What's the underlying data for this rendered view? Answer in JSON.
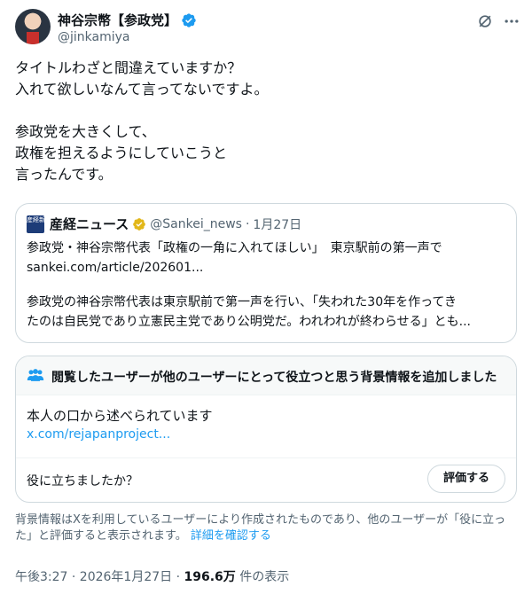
{
  "author": {
    "name": "神谷宗幣【参政党】",
    "handle": "@jinkamiya"
  },
  "tweet": {
    "text": "タイトルわざと間違えていますか？\n入れて欲しいなんて言ってないですよ。\n\n参政党を大きくして、\n政権を担えるようにしていこうと\n言ったんです。"
  },
  "quote": {
    "logo_text": "産経新聞",
    "name": "産経ニュース",
    "handle": "@Sankei_news",
    "separator": "·",
    "date": "1月27日",
    "title": "参政党・神谷宗幣代表「政権の一角に入れてほしい」　東京駅前の第一声で",
    "url": "sankei.com/article/202601...",
    "body_line1": "参政党の神谷宗幣代表は東京駅前で第一声を行い、「失われた30年を作ってき",
    "body_line2": "たのは自民党であり立憲民主党であり公明党だ。われわれが終わらせる」とも..."
  },
  "community_note": {
    "title": "閲覧したユーザーが他のユーザーにとって役立つと思う背景情報を追加しました",
    "text": "本人の口から述べられています",
    "link": "x.com/rejapanproject...",
    "question": "役に立ちましたか？",
    "rate_label": "評価する"
  },
  "disclaimer": {
    "text": "背景情報はXを利用しているユーザーにより作成されたものであり、他のユーザーが「役に立った」と評価すると表示されます。 ",
    "link": "詳細を確認する"
  },
  "footer": {
    "time": "午後3:27 · 2026年1月27日 · ",
    "views": "196.6万",
    "views_label": " 件の表示"
  },
  "colors": {
    "text": "#0f1419",
    "secondary": "#536471",
    "link": "#1d9bf0",
    "verified_blue": "#1d9bf0",
    "verified_gold": "#e2b719",
    "border": "#cfd9de"
  },
  "icons": [
    "verified-badge-icon",
    "grok-icon",
    "more-icon",
    "gold-verified-icon",
    "community-notes-icon"
  ]
}
